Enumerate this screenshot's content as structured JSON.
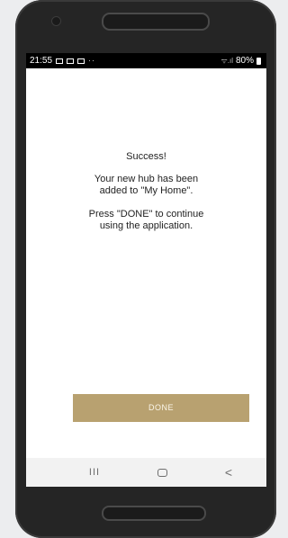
{
  "status_bar": {
    "time": "21:55",
    "notification_dots": "··",
    "signal_text": "ᯤ.ıl",
    "battery_percent": "80%"
  },
  "message": {
    "title": "Success!",
    "line1": "Your new hub has been",
    "line2": "added to \"My Home\".",
    "line3": "Press \"DONE\" to continue",
    "line4": "using the application."
  },
  "done_button": {
    "label": "DONE"
  },
  "nav_bar": {
    "recents": "III",
    "back": "<"
  },
  "colors": {
    "button_background": "#b8a170",
    "status_bar": "#000000",
    "nav_bar": "#f2f2f2",
    "phone_body": "#252525"
  },
  "icons": [
    "image-notification-icon",
    "mail-notification-icon",
    "message-notification-icon",
    "wifi-icon",
    "battery-icon",
    "recents-icon",
    "home-icon",
    "back-icon"
  ]
}
